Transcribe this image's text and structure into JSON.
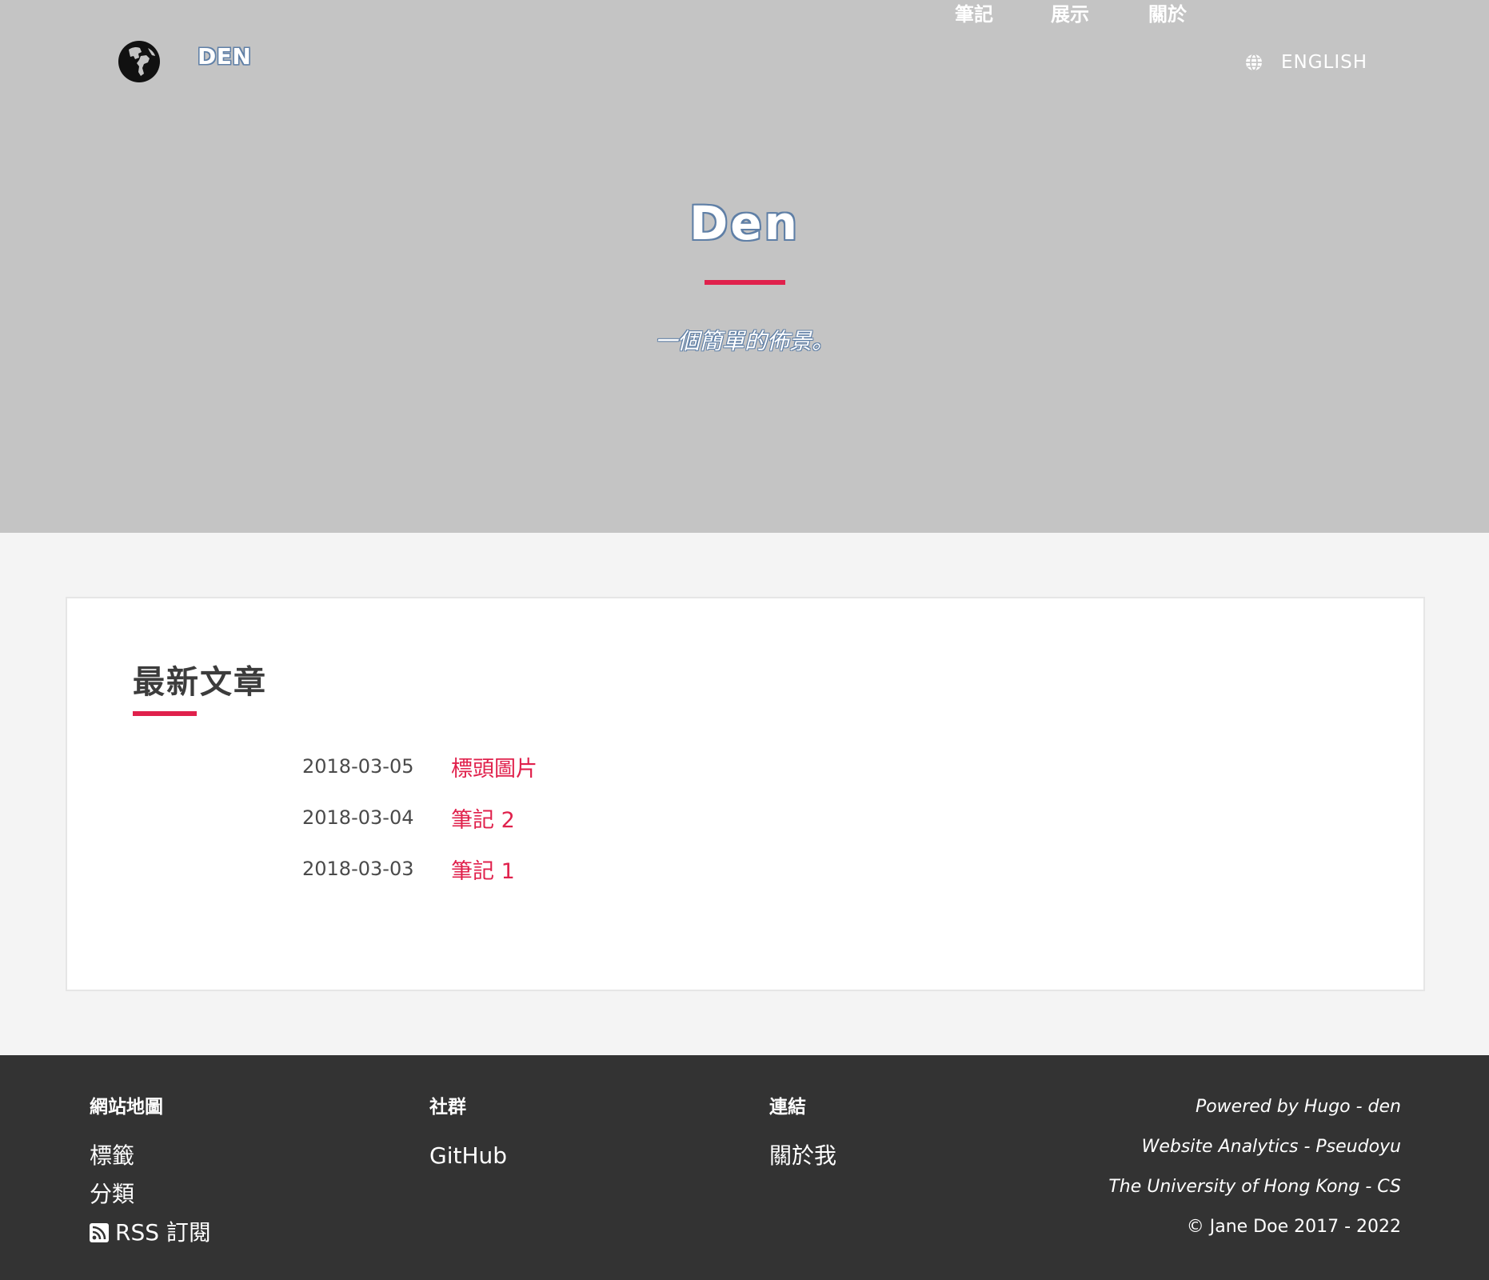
{
  "colors": {
    "hero_bg": "#c4c4c4",
    "accent": "#e0214c",
    "outline": "#5f7fa6",
    "footer_bg": "#333333",
    "page_bg": "#f4f4f4"
  },
  "nav": {
    "logo_icon": "globe-americas-icon",
    "brand": "DEN",
    "items": [
      {
        "label": "筆記"
      },
      {
        "label": "展示"
      },
      {
        "label": "關於"
      }
    ],
    "language": {
      "icon": "globe-icon",
      "label": "ENGLISH"
    }
  },
  "hero": {
    "title": "Den",
    "subtitle": "一個簡單的佈景。"
  },
  "recent": {
    "title": "最新文章",
    "posts": [
      {
        "date": "2018-03-05",
        "title": "標頭圖片"
      },
      {
        "date": "2018-03-04",
        "title": "筆記 2"
      },
      {
        "date": "2018-03-03",
        "title": "筆記 1"
      }
    ]
  },
  "footer": {
    "sitemap": {
      "heading": "網站地圖",
      "links": [
        "標籤",
        "分類"
      ],
      "rss": {
        "icon": "rss-icon",
        "label": "RSS 訂閱"
      }
    },
    "social": {
      "heading": "社群",
      "links": [
        "GitHub"
      ]
    },
    "links": {
      "heading": "連結",
      "links": [
        "關於我"
      ]
    },
    "credits": [
      "Powered by Hugo - den",
      "Website Analytics - Pseudoyu",
      "The University of Hong Kong - CS"
    ],
    "copyright": "© Jane Doe 2017 - 2022"
  }
}
